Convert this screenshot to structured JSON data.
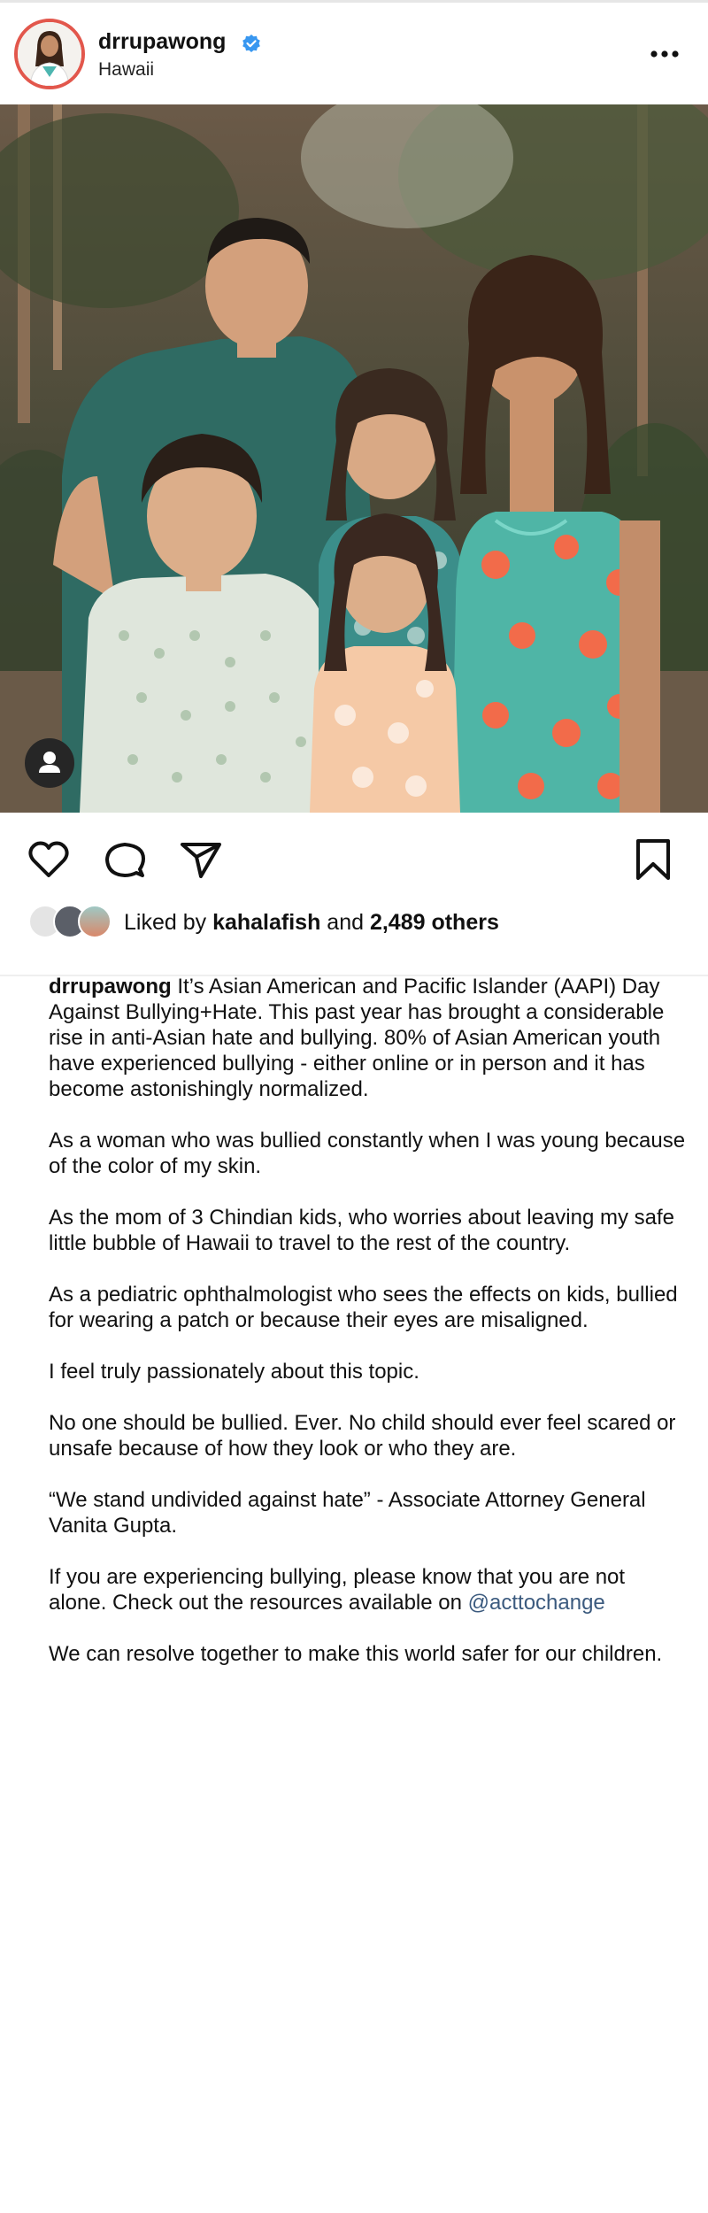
{
  "post": {
    "username": "drrupawong",
    "location": "Hawaii",
    "verified": true,
    "more_icon": "more-horizontal-icon"
  },
  "actions": {
    "like_icon": "heart-icon",
    "comment_icon": "comment-icon",
    "share_icon": "send-icon",
    "save_icon": "bookmark-icon",
    "tag_icon": "person-tag-icon"
  },
  "likes": {
    "prefix": "Liked by ",
    "user": "kahalafish",
    "middle": " and ",
    "count": "2,489 others"
  },
  "caption": {
    "username": "drrupawong",
    "p1": "It’s Asian American and Pacific Islander (AAPI) Day Against Bullying+Hate. This past year has brought a considerable rise in anti-Asian hate and bullying.  80% of Asian American youth have experienced bullying - either online or in person and it has become astonishingly normalized.",
    "p2": "As a woman who was bullied constantly when I was young because of the color of my skin.",
    "p3": "As the mom of 3 Chindian kids, who worries about leaving my safe little bubble of Hawaii to travel to the rest of the country.",
    "p4": "As a pediatric ophthalmologist who sees the effects on kids, bullied for wearing a patch or because their eyes are misaligned.",
    "p5": "I feel truly passionately about this topic.",
    "p6": "No one should be bullied. Ever. No child should ever feel scared or unsafe because of how they look or who they are.",
    "p7": "“We stand undivided against hate” - Associate Attorney General Vanita Gupta.",
    "p8": "If you are experiencing bullying, please know that you are not alone. Check out the resources available on",
    "p8_mention": "@acttochange",
    "p9": "We can resolve together to make this world safer for our children."
  },
  "colors": {
    "avatar_ring": "#e2574c",
    "verified_badge": "#3897f0",
    "mention": "#3b5a7e"
  }
}
